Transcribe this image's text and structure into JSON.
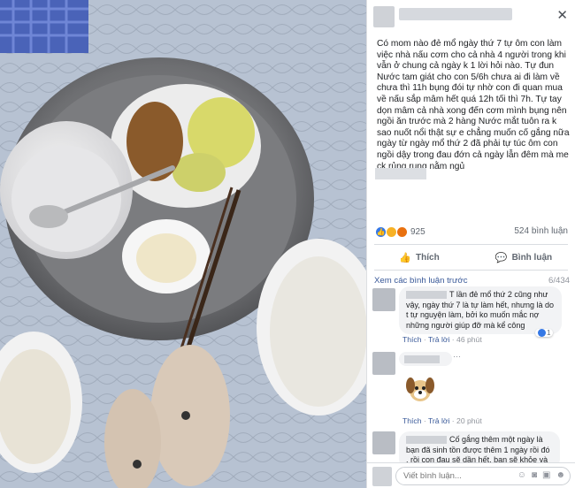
{
  "post": {
    "close_icon": "✕",
    "body_text": "Có mom nào đẻ mổ ngày thứ 7 tự ôm con làm việc nhà nấu cơm cho cả nhà 4 người trong khi vẫn ở chung cả ngày k 1 lời hỏi nào. Tự đun Nước tam giát cho con 5/6h chưa ai đi làm về chưa thì 11h bụng đói tự nhờ con đi quan mua về nấu sắp mâm hết quá 12h tối thì 7h. Tự tay dọn mâm cả nhà xong đến cơm mình bụng nên ngồi ăn trước mà 2 hàng Nước mắt tuôn ra k sao nuốt nổi thật sự e chẳng muốn cố gắng nữa ngày từ ngày mổ thứ 2 đã phải tự túc ôm con ngồi dậy trong đau đớn cả ngày lẫn đêm mà me ck rủng rung nằm ngủ",
    "reaction_count": "925",
    "comment_count": "524 bình luận"
  },
  "actions": {
    "like_label": "Thích",
    "comment_label": "Bình luận"
  },
  "comments_header": {
    "prev_link": "Xem các bình luận trước",
    "count": "6/434"
  },
  "comments": [
    {
      "text": "T lần đẻ mổ thứ 2 cũng như vậy, ngày thứ 7 là tự làm hết, nhưng là do t tự nguyện làm, bởi ko muốn mắc nợ những người giúp đỡ mà kể công",
      "like": "Thích",
      "reply": "Trả lời",
      "time": "46 phút",
      "reactions": "1"
    },
    {
      "text": "",
      "like": "Thích",
      "reply": "Trả lời",
      "time": "20 phút"
    },
    {
      "text": "Cố gắng thêm một ngày là bạn đã sinh tồn được thêm 1 ngày rồi đó , rồi con đau sẽ dần hết, bạn sẽ khỏe và"
    }
  ],
  "compose": {
    "placeholder": "Viết bình luận..."
  }
}
